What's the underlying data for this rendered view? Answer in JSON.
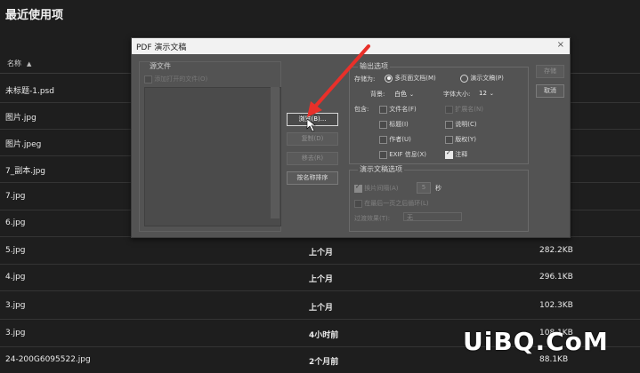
{
  "page": {
    "title": "最近使用项",
    "column_name": "名称"
  },
  "files": [
    {
      "name": "未标题-1.psd",
      "time": "",
      "size": ""
    },
    {
      "name": "图片.jpg",
      "time": "",
      "size": ""
    },
    {
      "name": "图片.jpeg",
      "time": "",
      "size": ""
    },
    {
      "name": "7_副本.jpg",
      "time": "",
      "size": ""
    },
    {
      "name": "7.jpg",
      "time": "",
      "size": ""
    },
    {
      "name": "6.jpg",
      "time": "",
      "size": ""
    },
    {
      "name": "5.jpg",
      "time": "上个月",
      "size": "282.2KB"
    },
    {
      "name": "4.jpg",
      "time": "上个月",
      "size": "296.1KB"
    },
    {
      "name": "3.jpg",
      "time": "上个月",
      "size": "102.3KB"
    },
    {
      "name": "3.jpg",
      "time": "4小时前",
      "size": "108.1KB"
    },
    {
      "name": "24-200G6095522.jpg",
      "time": "2个月前",
      "size": "88.1KB"
    }
  ],
  "dialog": {
    "title": "PDF 演示文稿",
    "close": "×",
    "source": {
      "title": "源文件",
      "add_open": "添加打开的文件(O)"
    },
    "buttons": {
      "browse": "浏览(B)...",
      "duplicate": "复制(D)",
      "remove": "移去(R)",
      "sort": "按名称排序",
      "save": "存储",
      "cancel": "取消"
    },
    "output": {
      "title": "输出选项",
      "save_as_label": "存储为:",
      "multi_page": "多页面文档(M)",
      "presentation": "演示文稿(P)",
      "bg_label": "背景:",
      "bg_value": "白色",
      "font_label": "字体大小:",
      "font_value": "12",
      "include_label": "包含:",
      "filename": "文件名(F)",
      "extension": "扩展名(N)",
      "title_opt": "标题(I)",
      "description": "说明(C)",
      "author": "作者(U)",
      "copyright": "版权(Y)",
      "exif": "EXIF 信息(X)",
      "notes": "注释"
    },
    "pres": {
      "title": "演示文稿选项",
      "advance": "换片间隔(A)",
      "seconds_value": "5",
      "seconds_unit": "秒",
      "loop": "在最后一页之后循环(L)",
      "transition_label": "过渡效果(T):",
      "transition_value": "无"
    }
  },
  "watermark": "UiBQ.CoM",
  "colors": {
    "bg": "#1e1e1e",
    "dialog": "#535353",
    "arrow": "#e8302a"
  }
}
